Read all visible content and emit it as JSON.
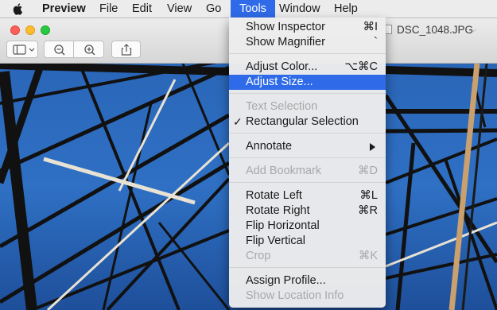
{
  "menubar": {
    "app_name": "Preview",
    "items": [
      "File",
      "Edit",
      "View",
      "Go",
      "Tools",
      "Window",
      "Help"
    ],
    "active_item": "Tools",
    "apple_icon": "apple-logo-icon"
  },
  "window": {
    "document_title": "DSC_1048.JPG",
    "toolbar": {
      "sidebar_icon": "sidebar-icon",
      "zoom_out_icon": "zoom-out-icon",
      "zoom_in_icon": "zoom-in-icon",
      "share_icon": "share-icon"
    },
    "traffic_lights": {
      "close": "#fc5f57",
      "minimize": "#fdbc2e",
      "zoom": "#28c840"
    }
  },
  "tools_menu": {
    "show_inspector": {
      "label": "Show Inspector",
      "shortcut": "⌘I"
    },
    "show_magnifier": {
      "label": "Show Magnifier",
      "shortcut": "`"
    },
    "adjust_color": {
      "label": "Adjust Color...",
      "shortcut": "⌥⌘C"
    },
    "adjust_size": {
      "label": "Adjust Size...",
      "shortcut": ""
    },
    "text_selection": {
      "label": "Text Selection",
      "shortcut": ""
    },
    "rectangular_selection": {
      "label": "Rectangular Selection",
      "checkmark": "✓"
    },
    "annotate": {
      "label": "Annotate"
    },
    "add_bookmark": {
      "label": "Add Bookmark",
      "shortcut": "⌘D"
    },
    "rotate_left": {
      "label": "Rotate Left",
      "shortcut": "⌘L"
    },
    "rotate_right": {
      "label": "Rotate Right",
      "shortcut": "⌘R"
    },
    "flip_horizontal": {
      "label": "Flip Horizontal",
      "shortcut": ""
    },
    "flip_vertical": {
      "label": "Flip Vertical",
      "shortcut": ""
    },
    "crop": {
      "label": "Crop",
      "shortcut": "⌘K"
    },
    "assign_profile": {
      "label": "Assign Profile...",
      "shortcut": ""
    },
    "show_location_info": {
      "label": "Show Location Info",
      "shortcut": ""
    },
    "highlight_color": "#2f6be8"
  }
}
